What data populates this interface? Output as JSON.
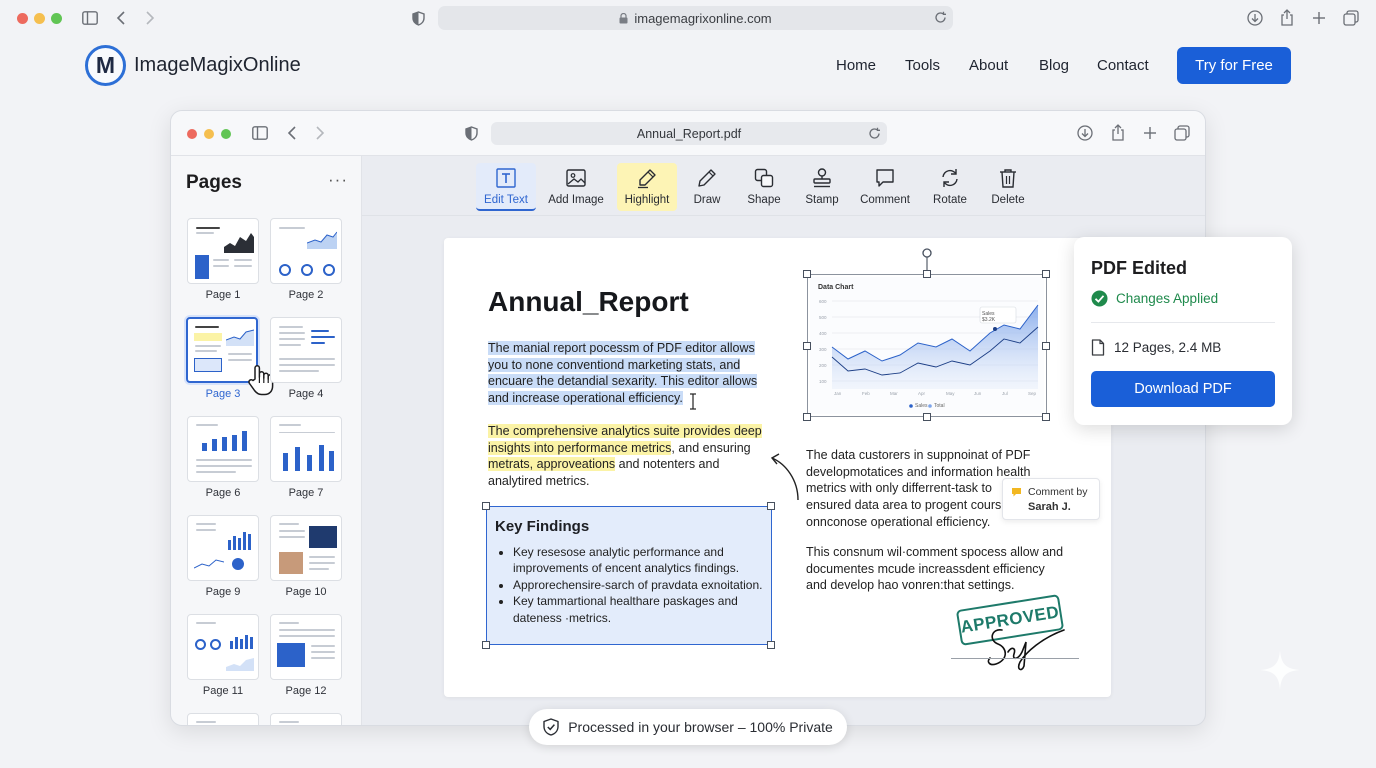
{
  "browser": {
    "url": "imagemagrixonline.com"
  },
  "site": {
    "logo_letter": "M",
    "brand": "ImageMagixOnline",
    "nav": [
      "Home",
      "Tools",
      "About",
      "Blog",
      "Contact"
    ],
    "cta": "Try for Free"
  },
  "app": {
    "url": "Annual_Report.pdf",
    "sidebar": {
      "title": "Pages",
      "more": "···",
      "pages": [
        {
          "label": "Page 1"
        },
        {
          "label": "Page 2"
        },
        {
          "label": "Page 3",
          "selected": true
        },
        {
          "label": "Page 4"
        },
        {
          "label": "Page 6"
        },
        {
          "label": "Page 7"
        },
        {
          "label": "Page 9"
        },
        {
          "label": "Page 10"
        },
        {
          "label": "Page 11"
        },
        {
          "label": "Page 12"
        }
      ]
    },
    "toolbar": [
      {
        "label": "Edit Text",
        "icon": "edit-text-icon",
        "state": "active"
      },
      {
        "label": "Add Image",
        "icon": "image-icon"
      },
      {
        "label": "Highlight",
        "icon": "highlighter-icon",
        "state": "highlighted"
      },
      {
        "label": "Draw",
        "icon": "pen-icon"
      },
      {
        "label": "Shape",
        "icon": "shape-icon"
      },
      {
        "label": "Stamp",
        "icon": "stamp-icon"
      },
      {
        "label": "Comment",
        "icon": "comment-icon"
      },
      {
        "label": "Rotate",
        "icon": "rotate-icon"
      },
      {
        "label": "Delete",
        "icon": "trash-icon"
      }
    ],
    "document": {
      "title": "Annual_Report",
      "para1_lines": [
        "The manial report pocessm of PDF editor allows",
        "you to none conventiond marketing stats, and",
        "encuare the detandial sexarity. This editor allows",
        "and increase operational efficiency."
      ],
      "para2": {
        "l1_hl": "The comprehensive analytics suite provides deep",
        "l2_hl": "insights into performance metrics",
        "l2_rest": ", and ensuring",
        "l3_hl": "metrats, approveations",
        "l3_rest": " and notenters and",
        "l4": "analytired metrics."
      },
      "key_findings": {
        "title": "Key Findings",
        "items": [
          "Key resesosе analytic performance and improvements of encent analytics findings.",
          "Approrechensire-sarch of pravdata exnoitation.",
          "Key tammartional healthare paskages and dateness ·metrics."
        ]
      },
      "right_para1_lines": [
        "The data custorers in suppnoinat of PDF",
        "developmotatices and information health",
        "metrics with only differrent-task to",
        "ensured data area to progent cours",
        "onnconose operational efficiency."
      ],
      "right_para2_lines": [
        "This consnum wil·comment spocess allow and",
        "documentes mcude increassdent efficiency",
        "and develop hao vonren:that settings."
      ],
      "comment": {
        "label": "Comment by",
        "author": "Sarah J."
      },
      "stamp": "APPROVED",
      "signature": "Sa",
      "chart": {
        "title": "Data Chart",
        "legend": [
          "Sales",
          "Total"
        ],
        "tooltip_value": "$3.2K"
      }
    },
    "status_card": {
      "title": "PDF Edited",
      "status": "Changes Applied",
      "info": "12 Pages, 2.4 MB",
      "button": "Download PDF"
    },
    "privacy": "Processed in your browser – 100% Private"
  },
  "colors": {
    "accent": "#1a5fd8",
    "success": "#1f8a4c",
    "selection": "#c9dcf7",
    "highlight": "#fbf3a6",
    "stamp": "#1e7a6a"
  }
}
